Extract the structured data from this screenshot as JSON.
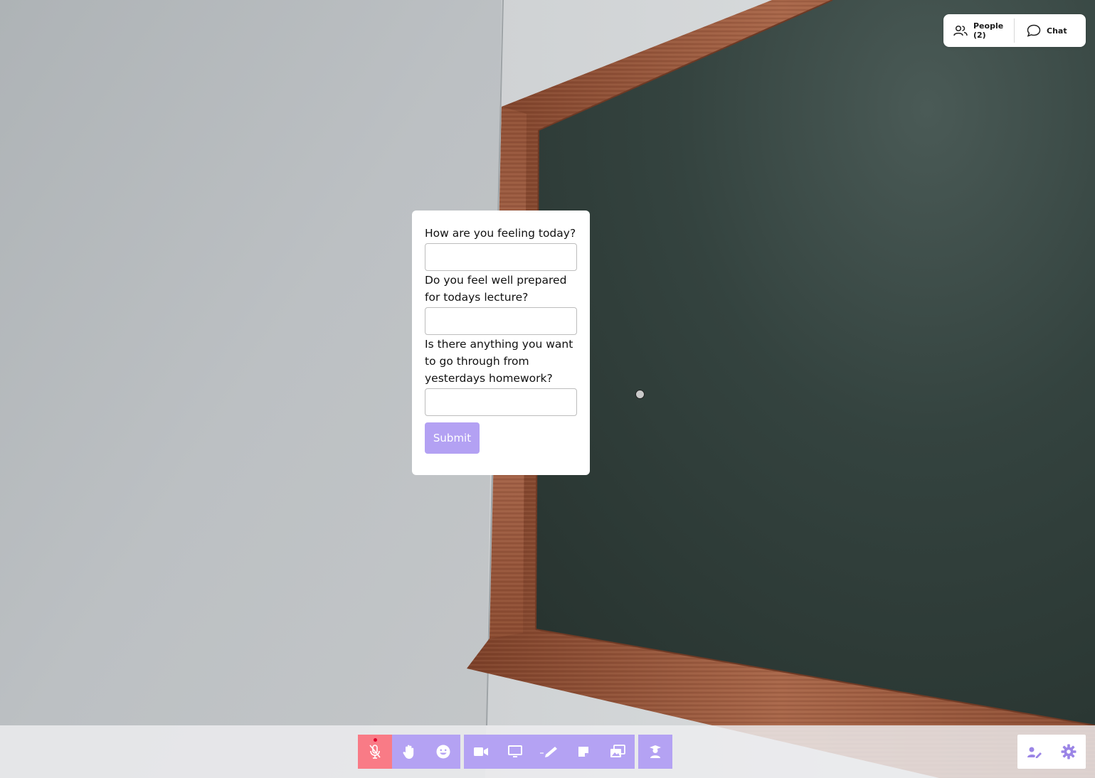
{
  "topbar": {
    "people_label": "People (2)",
    "chat_label": "Chat"
  },
  "form": {
    "questions": [
      {
        "label": "How are you feeling today?",
        "value": "",
        "placeholder": ""
      },
      {
        "label": "Do you feel well prepared for todays lecture?",
        "value": "",
        "placeholder": ""
      },
      {
        "label": "Is there anything you want to go through from yesterdays homework?",
        "value": "",
        "placeholder": ""
      }
    ],
    "submit_label": "Submit"
  },
  "toolbar": {
    "groups": [
      {
        "items": [
          {
            "icon": "microphone-muted-icon",
            "state": "muted"
          },
          {
            "icon": "raise-hand-icon"
          },
          {
            "icon": "emoji-icon"
          }
        ]
      },
      {
        "items": [
          {
            "icon": "video-camera-icon"
          },
          {
            "icon": "screen-share-icon"
          },
          {
            "icon": "pen-draw-icon"
          },
          {
            "icon": "sticky-note-icon"
          },
          {
            "icon": "image-gallery-icon"
          }
        ]
      },
      {
        "items": [
          {
            "icon": "teacher-icon"
          }
        ]
      }
    ],
    "right": [
      {
        "icon": "user-edit-icon"
      },
      {
        "icon": "settings-gear-icon"
      }
    ]
  },
  "colors": {
    "accent": "#b4a2f3",
    "mic_muted_bg": "#f97b86",
    "mic_dot": "#e0002a",
    "chalkboard": "#2f3d39",
    "wood_frame": "#9a5a3c",
    "wall": "#b8bcbf",
    "icon_purple": "#9b85e6"
  }
}
